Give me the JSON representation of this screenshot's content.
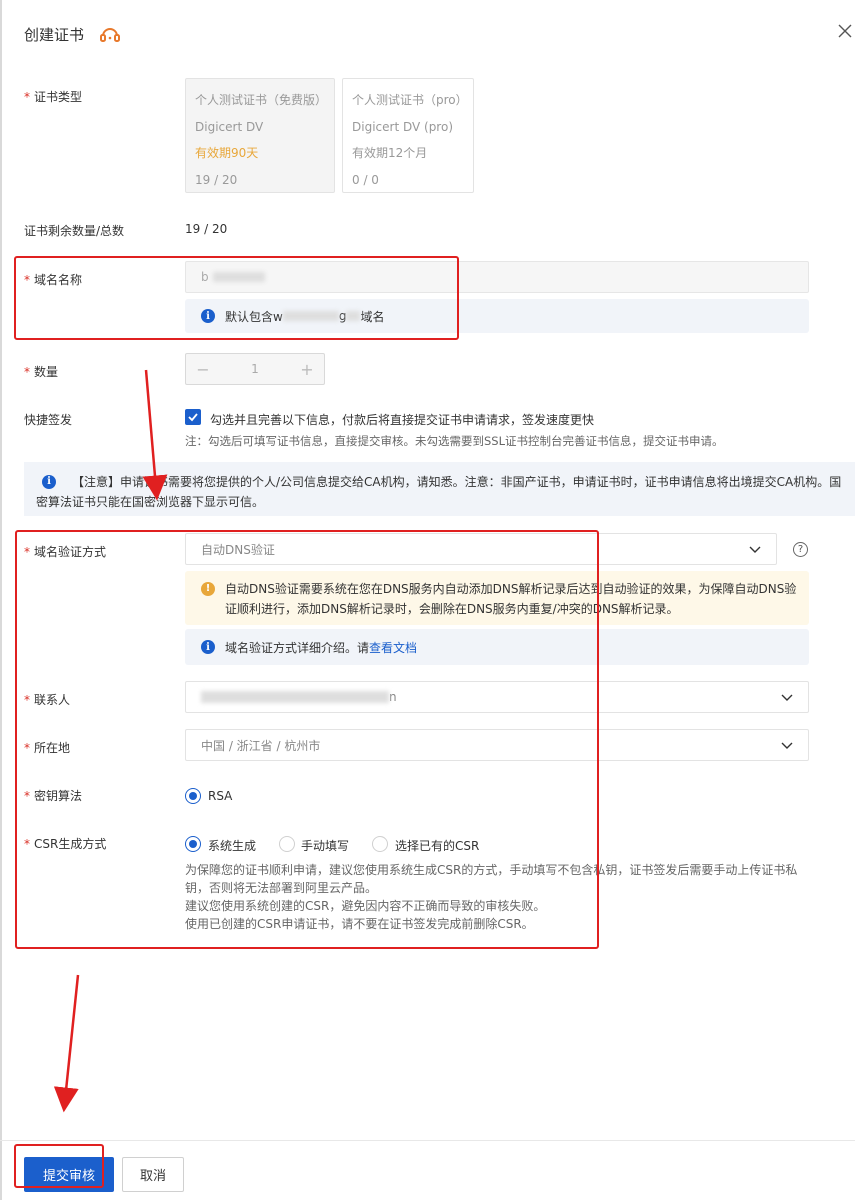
{
  "header": {
    "title": "创建证书"
  },
  "cert_type": {
    "label": "证书类型",
    "cards": [
      {
        "name": "个人测试证书（免费版）",
        "brand": "Digicert DV",
        "validity": "有效期90天",
        "count": "19 / 20",
        "selected": true
      },
      {
        "name": "个人测试证书（pro）",
        "brand": "Digicert DV (pro)",
        "validity": "有效期12个月",
        "count": "0 / 0",
        "selected": false
      }
    ]
  },
  "remaining": {
    "label": "证书剩余数量/总数",
    "value": "19 / 20"
  },
  "domain": {
    "label": "域名名称",
    "value": "b",
    "info_prefix": "默认包含w",
    "info_middle": "g",
    "info_suffix": "域名"
  },
  "quantity": {
    "label": "数量",
    "value": "1",
    "minus": "−",
    "plus": "+"
  },
  "quick_sign": {
    "label": "快捷签发",
    "checkbox_text": "勾选并且完善以下信息，付款后将直接提交证书申请请求，签发速度更快",
    "note": "注：勾选后可填写证书信息，直接提交审核。未勾选需要到SSL证书控制台完善证书信息，提交证书申请。"
  },
  "notice": {
    "line1": "【注意】申请证书需要将您提供的个人/公司信息提交给CA机构，请知悉。注意：非国产证书，申请证书时，证书申请信息将出境提交CA机构。国",
    "line2": "密算法证书只能在国密浏览器下显示可信。"
  },
  "verify": {
    "label": "域名验证方式",
    "value": "自动DNS验证",
    "warn_line1": "自动DNS验证需要系统在您在DNS服务内自动添加DNS解析记录后达到自动验证的效果，为保障自动DNS验",
    "warn_line2": "证顺利进行，添加DNS解析记录时，会删除在DNS服务内重复/冲突的DNS解析记录。",
    "info_text": "域名验证方式详细介绍。请",
    "info_link": "查看文档"
  },
  "contact": {
    "label": "联系人",
    "value": "n"
  },
  "location": {
    "label": "所在地",
    "value": "中国 / 浙江省 / 杭州市"
  },
  "key_algo": {
    "label": "密钥算法",
    "option": "RSA"
  },
  "csr": {
    "label": "CSR生成方式",
    "options": [
      "系统生成",
      "手动填写",
      "选择已有的CSR"
    ],
    "desc1": "为保障您的证书顺利申请，建议您使用系统生成CSR的方式，手动填写不包含私钥，证书签发后需要手动上传证书私",
    "desc2": "钥，否则将无法部署到阿里云产品。",
    "desc3": "建议您使用系统创建的CSR，避免因内容不正确而导致的审核失败。",
    "desc4": "使用已创建的CSR申请证书，请不要在证书签发完成前删除CSR。"
  },
  "required_mark": "*",
  "footer": {
    "submit": "提交审核",
    "cancel": "取消"
  },
  "colors": {
    "primary": "#1b5fcc",
    "annotation_red": "#e02020",
    "warning": "#e8a73a"
  },
  "icons": [
    "headset-icon",
    "close-icon",
    "info-icon",
    "warning-icon",
    "chevron-down-icon",
    "help-icon",
    "check-icon"
  ]
}
